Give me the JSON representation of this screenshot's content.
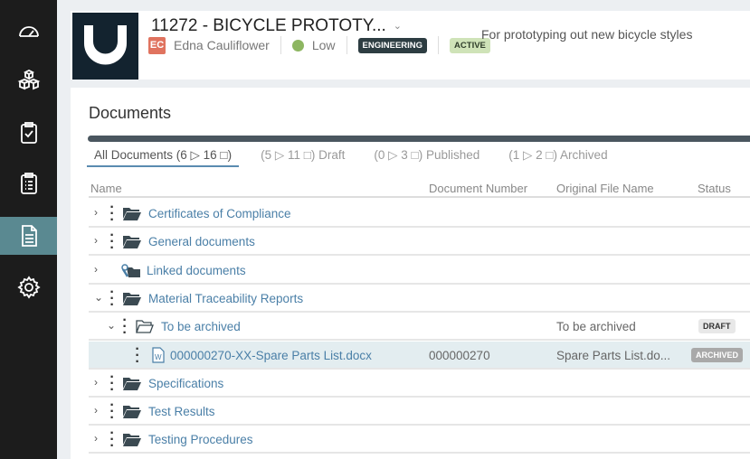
{
  "sidebar": {
    "items": [
      {
        "icon": "dashboard-icon"
      },
      {
        "icon": "cubes-icon"
      },
      {
        "icon": "clipboard-check-icon"
      },
      {
        "icon": "clipboard-list-icon"
      },
      {
        "icon": "document-icon",
        "active": true
      },
      {
        "icon": "gear-icon"
      }
    ]
  },
  "header": {
    "title": "11272 - BICYCLE PROTOTY...",
    "owner_initials": "EC",
    "owner": "Edna Cauliflower",
    "priority": "Low",
    "department": "ENGINEERING",
    "status": "ACTIVE",
    "description": "For prototyping out new bicycle styles",
    "colors": {
      "logo_bg": "#13232f",
      "priority": "#8db661",
      "dept_bg": "#2d3d42",
      "status_bg": "#cfe3b8"
    }
  },
  "documents": {
    "title": "Documents",
    "tabs": [
      {
        "label": "All Documents (6 ▷ 16 □)"
      },
      {
        "label": "(5 ▷ 11 □) Draft"
      },
      {
        "label": "(0 ▷ 3 □) Published"
      },
      {
        "label": "(1 ▷ 2 □) Archived"
      }
    ],
    "columns": [
      "Name",
      "Document Number",
      "Original File Name",
      "Status"
    ],
    "rows": [
      {
        "name": "Certificates of Compliance"
      },
      {
        "name": "General documents"
      },
      {
        "name": "Linked documents"
      },
      {
        "name": "Material Traceability Reports"
      },
      {
        "name": "To be archived",
        "original": "To be archived",
        "status": "DRAFT"
      },
      {
        "name": "000000270-XX-Spare Parts List.docx",
        "number": "000000270",
        "original": "Spare Parts List.do...",
        "status": "ARCHIVED"
      },
      {
        "name": "Specifications"
      },
      {
        "name": "Test Results"
      },
      {
        "name": "Testing Procedures"
      }
    ]
  }
}
